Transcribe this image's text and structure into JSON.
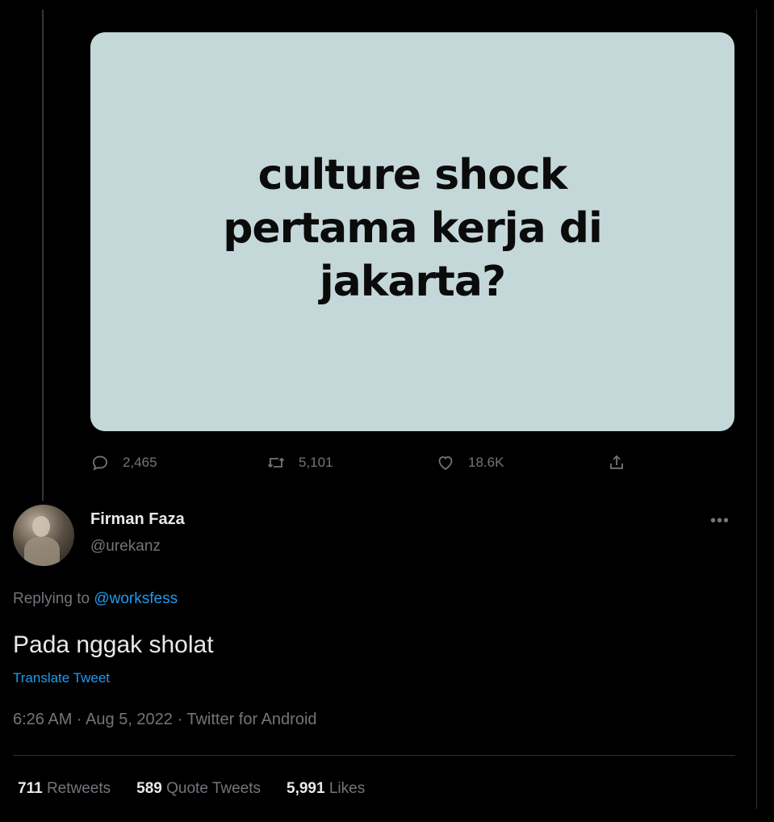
{
  "media": {
    "text": "culture shock pertama kerja di jakarta?",
    "background": "#c5d8d9"
  },
  "actions": {
    "reply": {
      "icon": "reply-icon",
      "count": "2,465"
    },
    "retweet": {
      "icon": "retweet-icon",
      "count": "5,101"
    },
    "like": {
      "icon": "heart-icon",
      "count": "18.6K"
    },
    "share": {
      "icon": "share-icon"
    }
  },
  "reply_tweet": {
    "author": {
      "name": "Firman Faza",
      "handle": "@urekanz"
    },
    "replying_prefix": "Replying to ",
    "replying_to": "@worksfess",
    "text": "Pada nggak sholat",
    "translate_label": "Translate Tweet",
    "meta": "6:26 AM · Aug 5, 2022 · Twitter for Android",
    "stats": {
      "retweets": {
        "count": "711",
        "label": "Retweets"
      },
      "quotes": {
        "count": "589",
        "label": "Quote Tweets"
      },
      "likes": {
        "count": "5,991",
        "label": "Likes"
      }
    }
  },
  "colors": {
    "background": "#000000",
    "link": "#1d9bf0",
    "muted": "#71767b",
    "text": "#e7e9ea"
  }
}
